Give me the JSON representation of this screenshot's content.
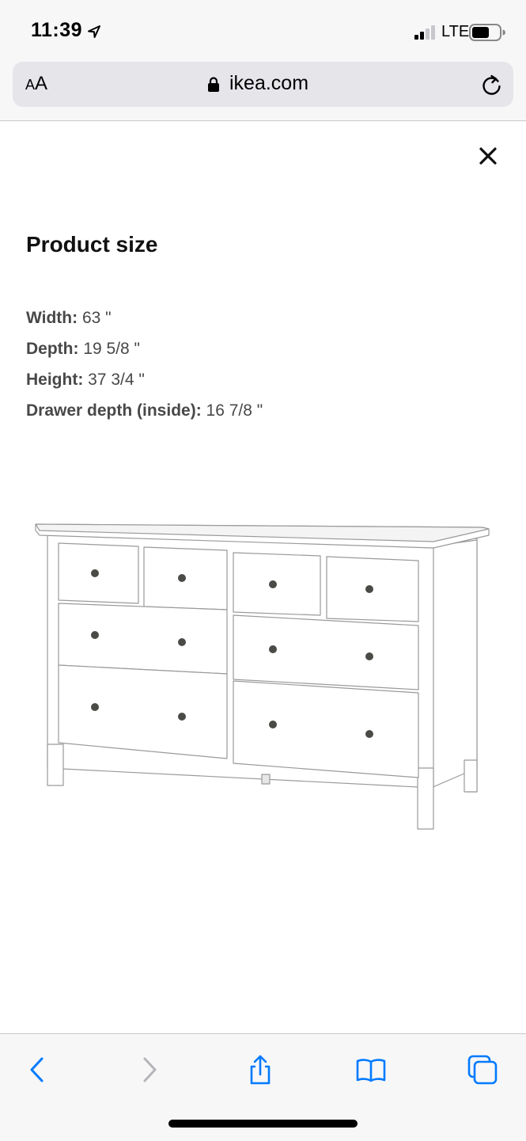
{
  "status_bar": {
    "time": "11:39",
    "network": "LTE",
    "icons": [
      "location-arrow-icon",
      "signal-bars-icon",
      "battery-icon"
    ]
  },
  "browser": {
    "reader_label_small": "A",
    "reader_label_large": "A",
    "url": "ikea.com",
    "icons": [
      "lock-icon",
      "reload-icon"
    ]
  },
  "modal": {
    "title": "Product size",
    "close_icon": "close-icon",
    "dimensions": [
      {
        "label": "Width:",
        "value": " 63 \""
      },
      {
        "label": "Depth:",
        "value": " 19 5/8 \""
      },
      {
        "label": "Height:",
        "value": " 37 3/4 \""
      },
      {
        "label": "Drawer depth (inside):",
        "value": " 16 7/8 \""
      }
    ],
    "image": "white-8-drawer-dresser-illustration"
  },
  "toolbar": {
    "items": [
      "back-icon",
      "forward-icon",
      "share-icon",
      "bookmarks-icon",
      "tabs-icon"
    ]
  },
  "colors": {
    "accent": "#007aff",
    "disabled": "#b4b4b9",
    "bar_background": "#f7f7f8"
  }
}
